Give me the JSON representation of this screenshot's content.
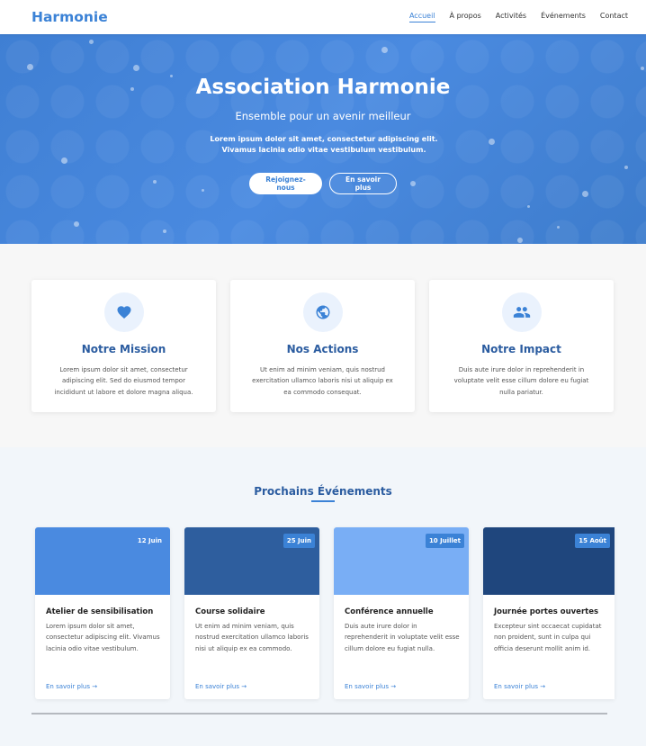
{
  "nav": {
    "brand": "Harmonie",
    "links": [
      "Accueil",
      "À propos",
      "Activités",
      "Événements",
      "Contact"
    ]
  },
  "hero": {
    "title": "Association Harmonie",
    "subtitle": "Ensemble pour un avenir meilleur",
    "description": "Lorem ipsum dolor sit amet, consectetur adipiscing elit. Vivamus lacinia odio vitae vestibulum vestibulum.",
    "primary_button": "Rejoignez-nous",
    "secondary_button": "En savoir plus"
  },
  "features": [
    {
      "icon": "heart-icon",
      "title": "Notre Mission",
      "text": "Lorem ipsum dolor sit amet, consectetur adipiscing elit. Sed do eiusmod tempor incididunt ut labore et dolore magna aliqua."
    },
    {
      "icon": "globe-icon",
      "title": "Nos Actions",
      "text": "Ut enim ad minim veniam, quis nostrud exercitation ullamco laboris nisi ut aliquip ex ea commodo consequat."
    },
    {
      "icon": "people-icon",
      "title": "Notre Impact",
      "text": "Duis aute irure dolor in reprehenderit in voluptate velit esse cillum dolore eu fugiat nulla pariatur."
    }
  ],
  "events": {
    "heading": "Prochains Événements",
    "cards": [
      {
        "date": "12 Juin",
        "color": "#4a8ae0",
        "title": "Atelier de sensibilisation",
        "text": "Lorem ipsum dolor sit amet, consectetur adipiscing elit. Vivamus lacinia odio vitae vestibulum.",
        "link": "En savoir plus →"
      },
      {
        "date": "25 Juin",
        "color": "#2e5e9e",
        "title": "Course solidaire",
        "text": "Ut enim ad minim veniam, quis nostrud exercitation ullamco laboris nisi ut aliquip ex ea commodo.",
        "link": "En savoir plus →"
      },
      {
        "date": "10 Juillet",
        "color": "#79aef5",
        "title": "Conférence annuelle",
        "text": "Duis aute irure dolor in reprehenderit in voluptate velit esse cillum dolore eu fugiat nulla.",
        "link": "En savoir plus →"
      },
      {
        "date": "15 Août",
        "color": "#1f467d",
        "title": "Journée portes ouvertes",
        "text": "Excepteur sint occaecat cupidatat non proident, sunt in culpa qui officia deserunt mollit anim id.",
        "link": "En savoir plus →"
      }
    ]
  },
  "colors": {
    "accent": "#3b82d6",
    "heading": "#2b5ca0"
  }
}
